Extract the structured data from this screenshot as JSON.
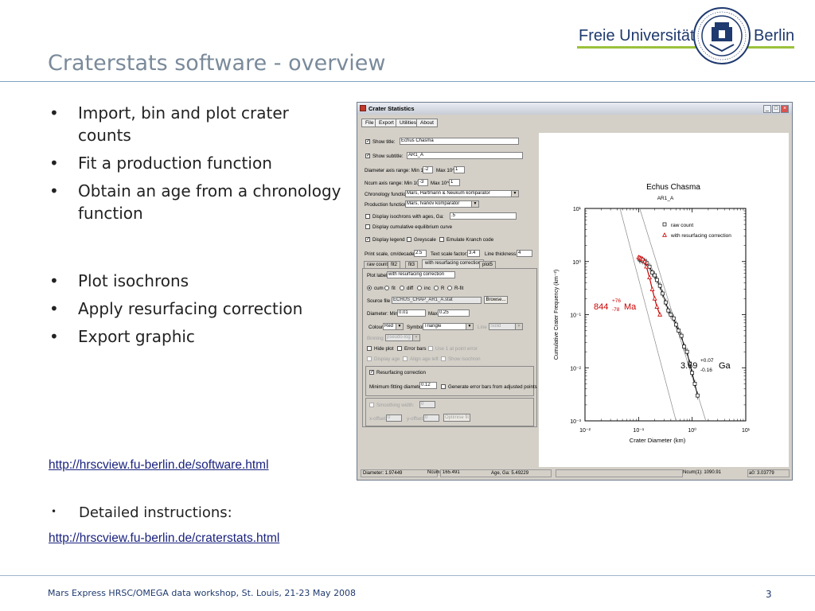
{
  "slide": {
    "title": "Craterstats software - overview",
    "logo": {
      "left_text": "Freie Universität",
      "right_text": "Berlin",
      "seal_text": "VERITAS IUSTITIA LIBERTAS · FREIE UNIVERSITÄT BERLIN"
    },
    "bullets": [
      "Import, bin and plot crater counts",
      "Fit a production function",
      "Obtain an age from a chronology function",
      "Plot isochrons",
      "Apply resurfacing correction",
      "Export graphic"
    ],
    "bullet_char": "•",
    "link1": "http://hrscview.fu-berlin.de/software.html",
    "detailed": "Detailed instructions:",
    "link2": "http://hrscview.fu-berlin.de/craterstats.html",
    "footer": "Mars Express HRSC/OMEGA data workshop, St. Louis, 21-23 May 2008",
    "page_number": "3"
  },
  "window": {
    "title": "Crater Statistics",
    "menu": [
      "File",
      "Export",
      "Utilities",
      "About"
    ],
    "show_title_label": "Show title:",
    "show_title_value": "Echus Chasma",
    "show_subtitle_label": "Show subtitle:",
    "show_subtitle_value": "AR1_A",
    "diam_range_label": "Diameter axis range: Min 10^",
    "diam_min": "-2",
    "diam_max_label": "Max 10^",
    "diam_max": "1",
    "ncum_range_label": "Ncum axis range: Min 10^",
    "ncum_min": "-3",
    "ncum_max_label": "Max 10^",
    "ncum_max": "1",
    "chronology_label": "Chronology function",
    "chronology_value": "Mars, Hartmann & Neukum komparator",
    "production_label": "Production function",
    "production_value": "Mars, Ivanov komparator",
    "isochrons_label": "Display isochrons with ages, Ga:",
    "isochrons_value": ".5",
    "cumulative_label": "Display cumulative equilibrium curve",
    "display_legend": "Display legend",
    "greyscale": "Greyscale",
    "emulate": "Emulate Kranch code",
    "print_scale_label": "Print scale, cm/decade:",
    "print_scale_value": "2.5",
    "text_scale_label": "Text scale factor:",
    "text_scale_value": "3.4",
    "line_thickness_label": "Line thickness:",
    "line_thickness_value": "4",
    "tabs": [
      "raw count",
      "fit2",
      "fit3",
      "with resurfacing correction",
      "plot5"
    ],
    "plot_label_label": "Plot label",
    "plot_label_value": "with resurfacing correction",
    "radio": [
      "cum",
      "fit",
      "diff",
      "inc",
      "R",
      "R-fit"
    ],
    "source_label": "Source file",
    "source_value": "ECHUS_CHAP_AR1_A.stat",
    "browse": "Browse...",
    "diam_min_label": "Diameter: Min",
    "diam_min_value": "0.01",
    "diam_max2_label": "Max",
    "diam_max2_value": "0.25",
    "colour_label": "Colour",
    "colour_value": "Red",
    "symbol_label": "Symbol",
    "symbol_value": "Triangle",
    "line_label": "Line",
    "line_value": "Solid",
    "binning_label": "Binning",
    "binning_value": "pseudo-log",
    "hide_plot": "Hide plot",
    "error_bars": "Error bars",
    "use_fit_point": "Use 1 at point error",
    "display_age": "Display age",
    "align_age": "Align age left",
    "show_isochron": "Show isochron",
    "resurfacing": "Resurfacing correction",
    "min_fit_label": "Minimum fitting diameter:",
    "min_fit_value": "0.12",
    "gen_err": "Generate error bars from adjusted points",
    "smoothing_label": "Smoothing width:",
    "smoothing_value": "0",
    "xoffset_label": "x-offset:",
    "xoffset_value": "0",
    "yoffset_label": "y-offset:",
    "yoffset_value": "0",
    "optimise": "Optimise fit",
    "status": [
      "Diameter: 1.97449",
      "Ncum: 165.491",
      "Age, Ga: 5.49229",
      "Ncum(1): 1090.91",
      "a0: 3.03779"
    ]
  },
  "chart_data": {
    "type": "scatter",
    "title": "Echus Chasma",
    "subtitle": "AR1_A",
    "xlabel": "Crater Diameter (km)",
    "ylabel": "Cumulative Crater Frequency (km⁻²)",
    "x_scale": "log",
    "y_scale": "log",
    "xlim": [
      0.01,
      10
    ],
    "ylim": [
      0.001,
      10
    ],
    "x_ticks": [
      "10⁻²",
      "10⁻¹",
      "10⁰",
      "10¹"
    ],
    "y_ticks": [
      "10¹",
      "10⁰",
      "10⁻¹",
      "10⁻²",
      "10⁻³"
    ],
    "legend": [
      "raw count",
      "with resurfacing correction"
    ],
    "legend_position": "top-right",
    "series": [
      {
        "name": "raw count",
        "color": "#000000",
        "marker": "square",
        "x": [
          0.105,
          0.11,
          0.12,
          0.13,
          0.14,
          0.16,
          0.18,
          0.2,
          0.22,
          0.25,
          0.28,
          0.32,
          0.36,
          0.4,
          0.45,
          0.5,
          0.56,
          0.63,
          0.71,
          0.8,
          0.9,
          1.0,
          1.12,
          1.26
        ],
        "y": [
          1.1,
          1.08,
          1.05,
          1.0,
          0.95,
          0.8,
          0.62,
          0.55,
          0.45,
          0.35,
          0.25,
          0.17,
          0.12,
          0.1,
          0.085,
          0.065,
          0.05,
          0.04,
          0.025,
          0.02,
          0.012,
          0.008,
          0.005,
          0.003
        ]
      },
      {
        "name": "with resurfacing correction",
        "color": "#cc0000",
        "marker": "triangle",
        "x": [
          0.1,
          0.105,
          0.11,
          0.115,
          0.12,
          0.13,
          0.14,
          0.16,
          0.18,
          0.2,
          0.22,
          0.25
        ],
        "y": [
          1.2,
          1.18,
          1.15,
          1.12,
          1.1,
          1.0,
          0.8,
          0.5,
          0.3,
          0.2,
          0.14,
          0.1
        ]
      }
    ],
    "isochrons": [
      {
        "name": "isochron-left",
        "x": [
          0.045,
          0.5
        ],
        "y": [
          10,
          0.001
        ]
      },
      {
        "name": "isochron-right",
        "x": [
          0.105,
          1.8
        ],
        "y": [
          10,
          0.001
        ]
      }
    ],
    "annotations": [
      {
        "text": "844",
        "sup": "+76",
        "sub": "-78",
        "unit": "Ma",
        "color": "#cc0000"
      },
      {
        "text": "3.69",
        "sup": "+0.07",
        "sub": "-0.16",
        "unit": "Ga",
        "color": "#000000"
      }
    ]
  }
}
